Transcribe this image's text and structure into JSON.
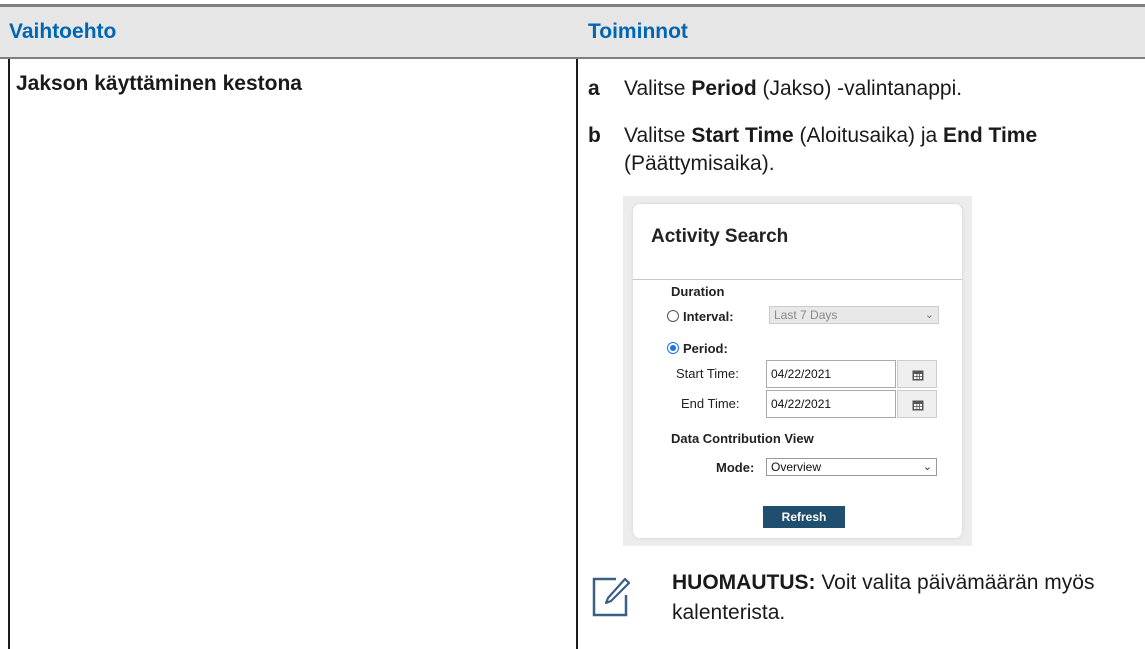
{
  "table": {
    "headers": [
      "Vaihtoehto",
      "Toiminnot"
    ],
    "row_option": "Jakson käyttäminen kestona"
  },
  "steps": [
    {
      "letter": "a",
      "pre": "Valitse ",
      "bold1": "Period",
      "mid": " (Jakso) -valintanappi.",
      "bold2": "",
      "post": ""
    },
    {
      "letter": "b",
      "pre": "Valitse ",
      "bold1": "Start Time",
      "mid": " (Aloitusaika) ja ",
      "bold2": "End Time",
      "post": " (Päättymisaika)."
    }
  ],
  "figure": {
    "title": "Activity Search",
    "duration_label": "Duration",
    "interval_label": "Interval:",
    "interval_value": "Last 7 Days",
    "period_label": "Period:",
    "start_label": "Start Time:",
    "start_value": "04/22/2021",
    "end_label": "End Time:",
    "end_value": "04/22/2021",
    "dcv_label": "Data Contribution View",
    "mode_label": "Mode:",
    "mode_value": "Overview",
    "refresh_label": "Refresh",
    "interval_selected": false,
    "period_selected": true
  },
  "note": {
    "label": "HUOMAUTUS:",
    "text": " Voit valita päivämäärän myös kalenterista."
  },
  "colors": {
    "header_text": "#0066b3",
    "header_bg": "#e6e6e6",
    "refresh_bg": "#1f4e6e",
    "radio_accent": "#1a73e8"
  }
}
